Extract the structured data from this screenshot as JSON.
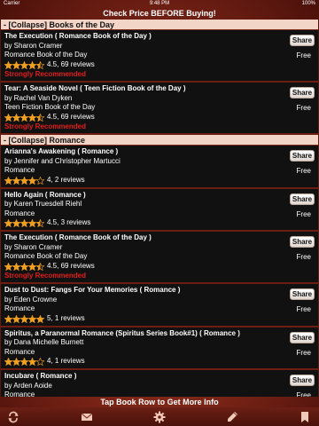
{
  "status_bar": {
    "carrier": "Carrier",
    "time": "9:48 PM",
    "battery": "100%"
  },
  "top_banner": "Check Price BEFORE Buying!",
  "bottom_banner": "Tap Book Row to Get More Info",
  "share_label": "Share",
  "sections": [
    {
      "header": "- [Collapse]  Books of the Day",
      "books": [
        {
          "title": "The Execution ( Romance Book of the Day )",
          "author": "by Sharon Cramer",
          "category": "Romance Book of the Day",
          "rating_text": "4.5, 69 reviews",
          "stars": 4.5,
          "recommended": "Strongly Recommended",
          "price": "Free"
        },
        {
          "title": "Tear: A Seaside Novel ( Teen Fiction Book of the Day )",
          "author": "by Rachel Van Dyken",
          "category": "Teen Fiction Book of the Day",
          "rating_text": "4.5, 69 reviews",
          "stars": 4.5,
          "recommended": "Strongly Recommended",
          "price": "Free"
        }
      ]
    },
    {
      "header": "- [Collapse]  Romance",
      "books": [
        {
          "title": "Arianna's Awakening ( Romance )",
          "author": "by Jennifer and Christopher Martucci",
          "category": "Romance",
          "rating_text": "4, 2 reviews",
          "stars": 4,
          "recommended": "",
          "price": "Free"
        },
        {
          "title": "Hello Again ( Romance )",
          "author": "by Karen Truesdell Riehl",
          "category": "Romance",
          "rating_text": "4.5, 3 reviews",
          "stars": 4.5,
          "recommended": "",
          "price": "Free"
        },
        {
          "title": "The Execution ( Romance Book of the Day )",
          "author": "by Sharon Cramer",
          "category": "Romance Book of the Day",
          "rating_text": "4.5, 69 reviews",
          "stars": 4.5,
          "recommended": "Strongly Recommended",
          "price": "Free"
        },
        {
          "title": "Dust to Dust: Fangs For Your Memories ( Romance )",
          "author": "by Eden Crowne",
          "category": "Romance",
          "rating_text": "5, 1 reviews",
          "stars": 5,
          "recommended": "",
          "price": "Free"
        },
        {
          "title": "Spiritus, a Paranormal Romance (Spiritus Series Book#1) ( Romance )",
          "author": "by Dana Michelle Burnett",
          "category": "Romance",
          "rating_text": "4, 1 reviews",
          "stars": 4,
          "recommended": "",
          "price": "Free"
        },
        {
          "title": "Incubare ( Romance )",
          "author": "by Arden Aoide",
          "category": "Romance",
          "rating_text": "",
          "stars": 0,
          "recommended": "",
          "price": "Free"
        }
      ]
    }
  ],
  "toolbar": {
    "icons": [
      "refresh-icon",
      "mail-icon",
      "settings-gear-icon",
      "edit-pencil-icon",
      "bookmark-icon"
    ]
  },
  "colors": {
    "star": "#f0a020",
    "recommended": "#e21e1e",
    "section_header_bg": "#f2d5c6"
  }
}
